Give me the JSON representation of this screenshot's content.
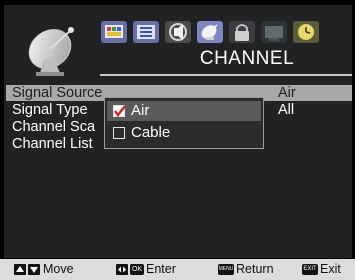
{
  "header": {
    "title": "CHANNEL"
  },
  "top_icons": [
    {
      "icon": "picture-icon"
    },
    {
      "icon": "list-icon"
    },
    {
      "icon": "audio-icon"
    },
    {
      "icon": "channel-satellite-icon"
    },
    {
      "icon": "lock-icon"
    },
    {
      "icon": "setup-icon"
    },
    {
      "icon": "timer-icon"
    }
  ],
  "menu_items": [
    {
      "label": "Signal Source",
      "value": "Air"
    },
    {
      "label": "Signal Type",
      "value": "All"
    },
    {
      "label": "Channel Sca",
      "value": ""
    },
    {
      "label": "Channel List",
      "value": ""
    }
  ],
  "dropdown": {
    "options": [
      {
        "label": "Air",
        "checked": true
      },
      {
        "label": "Cable",
        "checked": false
      }
    ]
  },
  "footer": {
    "move_label": "Move",
    "ok_key": "OK",
    "enter_label": "Enter",
    "menu_key": "MENU",
    "return_label": "Return",
    "exit_key": "EXIT",
    "exit_label": "Exit"
  },
  "colors": {
    "panel_bg": "#212224",
    "highlight_row": "#a8a8a8",
    "check_red": "#d3232a",
    "footer_bg": "#dcdcdc"
  }
}
